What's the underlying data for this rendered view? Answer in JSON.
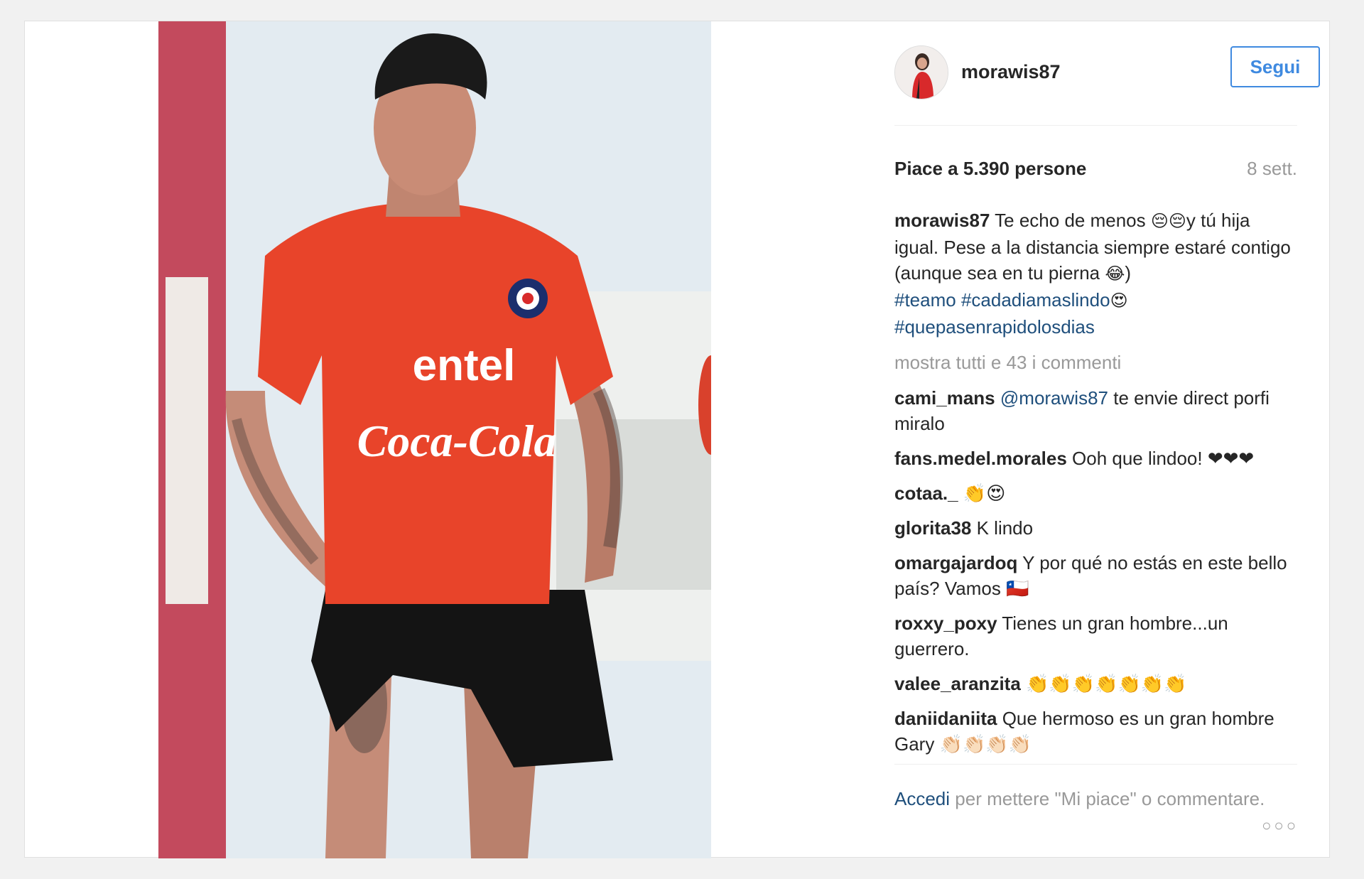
{
  "post": {
    "username": "morawis87",
    "follow_label": "Segui",
    "likes": "Piace a 5.390 persone",
    "time": "8 sett.",
    "caption": {
      "user": "morawis87",
      "text_1": " Te echo de menos ",
      "emoji_1": "😔😔",
      "text_2": "y tú hija igual. Pese a la distancia siempre estaré contigo (aunque sea en tu pierna ",
      "emoji_2": "😂",
      "text_3": ")",
      "tag_1": "#teamo",
      "tag_2": "#cadadiamaslindo",
      "emoji_3": "😍",
      "tag_3": "#quepasenrapidolosdias"
    },
    "show_all": "mostra tutti e 43 i commenti",
    "comments": [
      {
        "user": "cami_mans",
        "mention": "@morawis87",
        "text": " te envie direct porfi miralo"
      },
      {
        "user": "fans.medel.morales",
        "text": " Ooh que lindoo! ❤❤❤"
      },
      {
        "user": "cotaa._",
        "text": " 👏😍"
      },
      {
        "user": "glorita38",
        "text": " K lindo"
      },
      {
        "user": "omargajardoq",
        "text": " Y por qué no estás en este bello país? Vamos 🇨🇱"
      },
      {
        "user": "roxxy_poxy",
        "text": " Tienes un gran hombre...un guerrero."
      },
      {
        "user": "valee_aranzita",
        "text": " 👏👏👏👏👏👏👏"
      },
      {
        "user": "daniidaniita",
        "text": " Que hermoso es un gran hombre Gary 👏🏻👏🏻👏🏻👏🏻"
      }
    ],
    "footer": {
      "login": "Accedi",
      "rest": " per mettere \"Mi piace\" o commentare.",
      "more_icon": "more-options-icon"
    }
  },
  "photo": {
    "shirt_sponsor_1": "entel",
    "shirt_sponsor_2": "Coca-Cola",
    "colors": {
      "shirt": "#e8442a",
      "shorts": "#141414",
      "post": "#c9475a"
    }
  }
}
